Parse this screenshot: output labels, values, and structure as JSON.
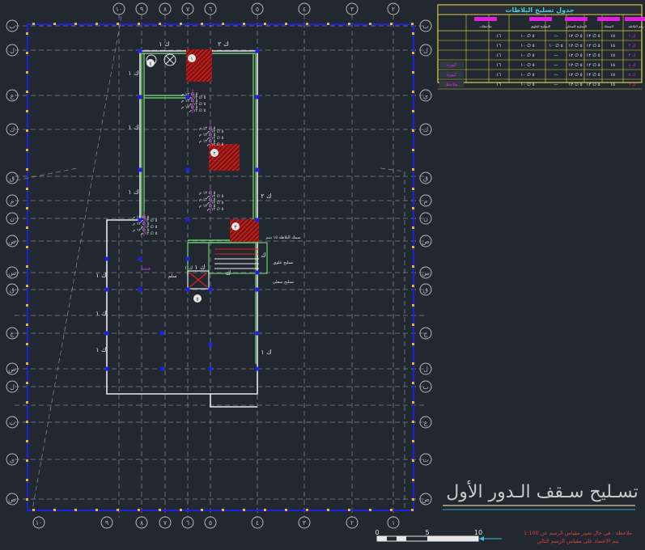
{
  "drawing": {
    "title": "تسـليح سـقف الـدور الأول",
    "colors": {
      "background": "#212830",
      "grid": "#7d858c",
      "beam_line": "#2020e0",
      "slab_outline": "#e8e8e8",
      "column_fill": "#b01818",
      "wall": "#6fc36f",
      "table_border": "#e0d040",
      "magenta": "#e020e0",
      "bubble": "#b8b8b8"
    },
    "top_axes": [
      "١٠",
      "٩",
      "٨",
      "٧",
      "٦",
      "٥",
      "٤",
      "٣",
      "٢",
      "١"
    ],
    "bottom_axes": [
      "١٠",
      "٩",
      "٨",
      "٧",
      "٦",
      "٥",
      "٤",
      "٣",
      "٢",
      "١"
    ],
    "left_axes": [
      "ب",
      "ل",
      "ع",
      "ك",
      "ق",
      "م",
      "ن",
      "ص",
      "س",
      "ق",
      "ج",
      "ص",
      "ل",
      "ب",
      "ي",
      "ص",
      "ك"
    ],
    "right_axes": [
      "ب",
      "ل",
      "ي",
      "ك",
      "ق",
      "م",
      "ن",
      "ص",
      "س",
      "ق",
      "ج",
      "ل",
      "ب",
      "ع",
      "ت",
      "ص",
      "ك"
    ],
    "slab_marks": [
      "ك ١",
      "ك ٢",
      "ك ١",
      "ك ١",
      "ك ١",
      "ك ٢",
      "ك ١",
      "ك ١",
      "ك ١",
      "ك ١",
      "ك ١",
      "ك ١",
      "ك"
    ],
    "column_marks": [
      "١",
      "٢",
      "٣",
      "٤",
      "٥"
    ],
    "rebar_notes": [
      "٥ ∅ ١٢ م",
      "٥ ∅ ١٢ م",
      "٥ ∅ ١٢ م",
      "٥ ∅ ١٢ م",
      "٥ ∅ ١٢ م"
    ],
    "stair_notes": [
      "سمك البلاطة ١٥ سم",
      "تسليح علوي",
      "تسليح سفلي"
    ],
    "local_labels": [
      "فتحة",
      "سلم",
      "ك ١"
    ]
  },
  "table": {
    "title": "جدول تسليح البلاطات",
    "header_labels": [
      "رقم البلاطة",
      "السمك",
      "التسليح السفلي",
      "التسليح العلوي",
      "ملاحظات"
    ],
    "rows": [
      [
        "ك ١",
        "١٥",
        "٥ ∅ ١٢",
        "٥ ∅ ١٢",
        "—",
        "٥ ∅ ١٠",
        "١٦"
      ],
      [
        "ك ٢",
        "١٥",
        "٥ ∅ ١٢",
        "٥ ∅ ١٢",
        "٥ ∅ ١٠",
        "٥ ∅ ١٠",
        "١٦"
      ],
      [
        "ك ٣",
        "١٥",
        "٥ ∅ ١٢",
        "٥ ∅ ١٢",
        "—",
        "٥ ∅ ١٠",
        "١٦"
      ],
      [
        "ك ٤",
        "١٥",
        "٥ ∅ ١٢",
        "٥ ∅ ١٢",
        "—",
        "٥ ∅ ١٠",
        "١٦"
      ],
      [
        "ك ٥",
        "١٥",
        "٥ ∅ ١٢",
        "٥ ∅ ١٢",
        "—",
        "٥ ∅ ١٠",
        "١٦"
      ],
      [
        "ك ٦",
        "١٥",
        "٥ ∅ ١٢",
        "٥ ∅ ١٢",
        "—",
        "٥ ∅ ١٠",
        "١٦"
      ]
    ],
    "side_tags": [
      "كمرة",
      "كمرة",
      "ملاحظ"
    ]
  },
  "footer": {
    "note_line1": "ملاحظة : في حال تغيير مقياس الرسم عن 1:100",
    "note_line2": "يتم الاعتماد على مقياس الرسم التالي",
    "scale_ticks": [
      "0",
      "5",
      "10"
    ]
  }
}
